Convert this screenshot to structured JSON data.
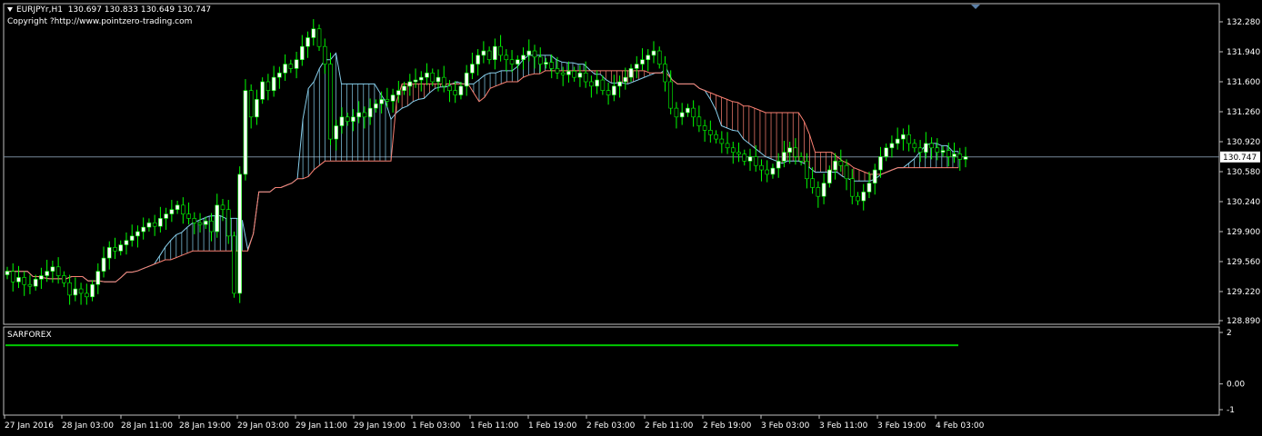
{
  "header": {
    "symbol": "EURJPYr,H1",
    "ohlc": "130.697 130.833 130.649 130.747",
    "copyright": "Copyright ?http://www.pointzero-trading.com"
  },
  "subwindow": {
    "label": "SARFOREX",
    "line_value": 1.5
  },
  "colors": {
    "background": "#000000",
    "frame": "#c0c0c0",
    "bull_candle": "#ffffff",
    "bear_candle": "#000000",
    "wick": "#00ff00",
    "cloud_bull": "#87ceeb",
    "cloud_bear": "#fa8072",
    "price_line": "#778899",
    "indicator_line": "#00c800"
  },
  "chart_data": {
    "type": "candlestick",
    "ylim": [
      128.89,
      132.35
    ],
    "y_ticks": [
      "132.280",
      "131.940",
      "131.600",
      "131.260",
      "130.920",
      "130.580",
      "130.240",
      "129.900",
      "129.560",
      "129.220",
      "128.890"
    ],
    "current_price": "130.747",
    "sub_ylim": [
      -1,
      2
    ],
    "sub_ticks": [
      "2",
      "0.00",
      "-1"
    ],
    "x_labels": [
      "27 Jan 2016",
      "28 Jan 03:00",
      "28 Jan 11:00",
      "28 Jan 19:00",
      "29 Jan 03:00",
      "29 Jan 11:00",
      "29 Jan 19:00",
      "1 Feb 03:00",
      "1 Feb 11:00",
      "1 Feb 19:00",
      "2 Feb 03:00",
      "2 Feb 11:00",
      "2 Feb 19:00",
      "3 Feb 03:00",
      "3 Feb 11:00",
      "3 Feb 19:00",
      "4 Feb 03:00"
    ],
    "closes": [
      129.45,
      129.33,
      129.38,
      129.3,
      129.28,
      129.36,
      129.4,
      129.45,
      129.5,
      129.4,
      129.32,
      129.18,
      129.25,
      129.2,
      129.16,
      129.3,
      129.45,
      129.6,
      129.72,
      129.68,
      129.75,
      129.8,
      129.85,
      129.9,
      129.95,
      130.0,
      129.96,
      130.05,
      130.1,
      130.15,
      130.2,
      130.1,
      130.05,
      130.0,
      129.98,
      130.02,
      129.9,
      130.2,
      130.15,
      129.85,
      129.2,
      130.55,
      131.5,
      131.2,
      131.4,
      131.6,
      131.5,
      131.65,
      131.7,
      131.8,
      131.75,
      131.85,
      132.0,
      132.1,
      132.2,
      132.0,
      131.8,
      130.95,
      131.1,
      131.2,
      131.15,
      131.2,
      131.25,
      131.2,
      131.3,
      131.35,
      131.4,
      131.38,
      131.45,
      131.5,
      131.55,
      131.6,
      131.62,
      131.65,
      131.7,
      131.6,
      131.65,
      131.55,
      131.5,
      131.45,
      131.55,
      131.7,
      131.8,
      131.9,
      131.95,
      131.85,
      132.0,
      131.9,
      131.85,
      131.8,
      131.85,
      131.9,
      131.95,
      131.88,
      131.8,
      131.82,
      131.75,
      131.7,
      131.68,
      131.72,
      131.65,
      131.7,
      131.6,
      131.55,
      131.62,
      131.5,
      131.45,
      131.55,
      131.6,
      131.65,
      131.75,
      131.8,
      131.85,
      131.9,
      131.95,
      131.8,
      131.6,
      131.3,
      131.2,
      131.25,
      131.3,
      131.2,
      131.1,
      131.05,
      131.0,
      130.95,
      130.9,
      130.85,
      130.8,
      130.78,
      130.7,
      130.75,
      130.65,
      130.6,
      130.55,
      130.62,
      130.7,
      130.8,
      130.85,
      130.75,
      130.7,
      130.5,
      130.4,
      130.3,
      130.45,
      130.6,
      130.7,
      130.65,
      130.5,
      130.3,
      130.25,
      130.35,
      130.45,
      130.6,
      130.75,
      130.85,
      130.9,
      130.95,
      131.0,
      130.9,
      130.85,
      130.8,
      130.9,
      130.85,
      130.8,
      130.82,
      130.75,
      130.78,
      130.72,
      130.75
    ]
  }
}
